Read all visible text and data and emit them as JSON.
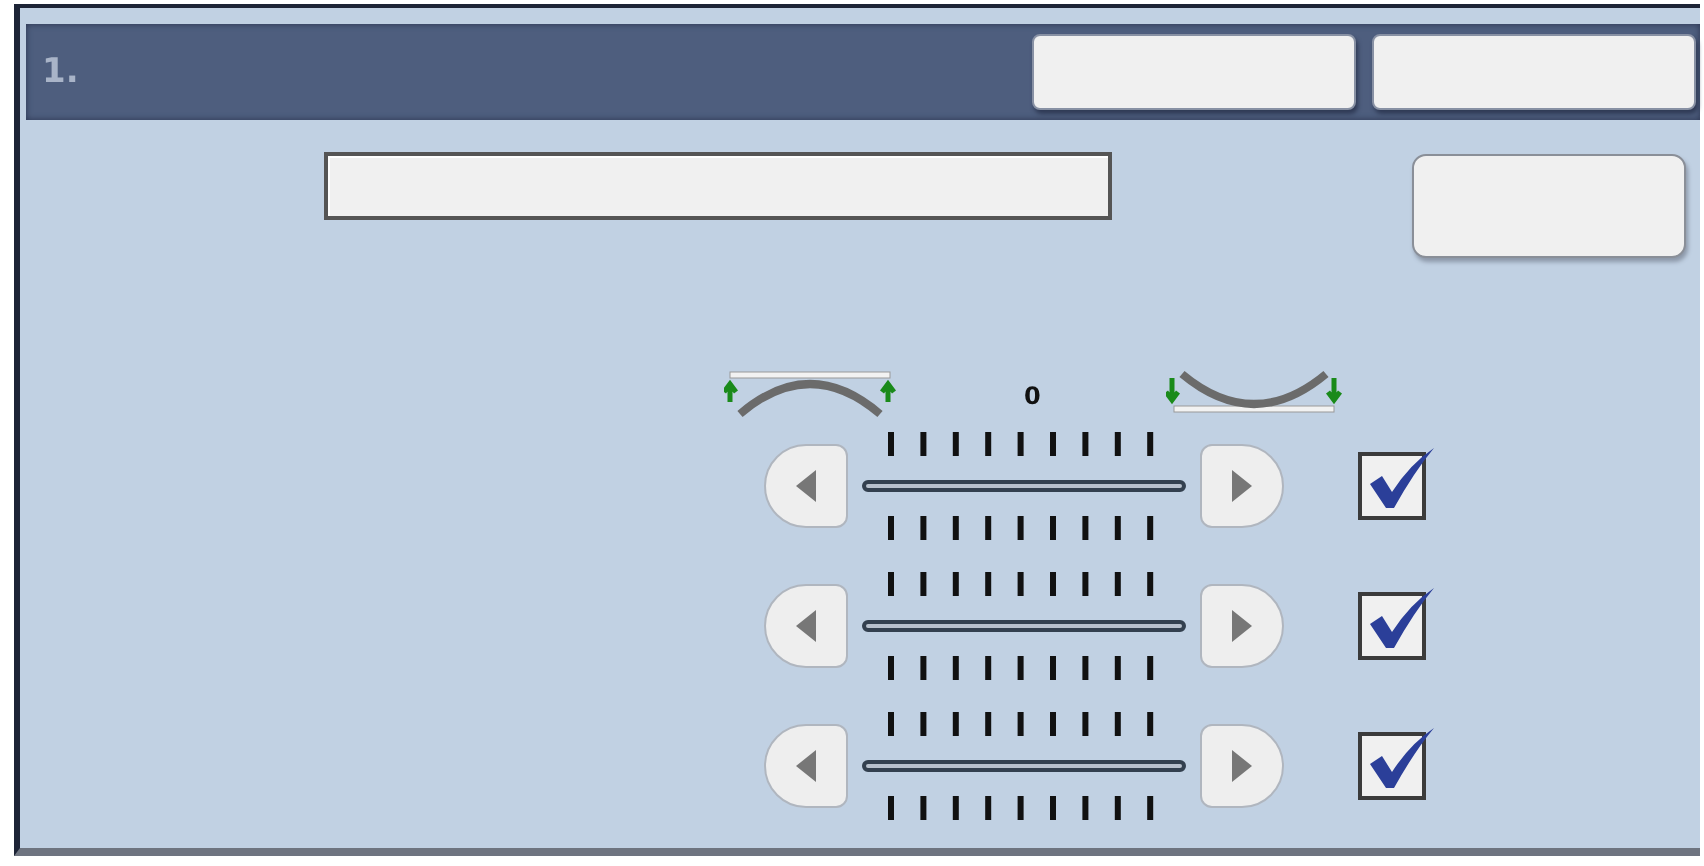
{
  "header": {
    "title": "1."
  },
  "scale": {
    "label": "0"
  },
  "rows": [
    {
      "checked": true
    },
    {
      "checked": true
    },
    {
      "checked": true
    }
  ]
}
